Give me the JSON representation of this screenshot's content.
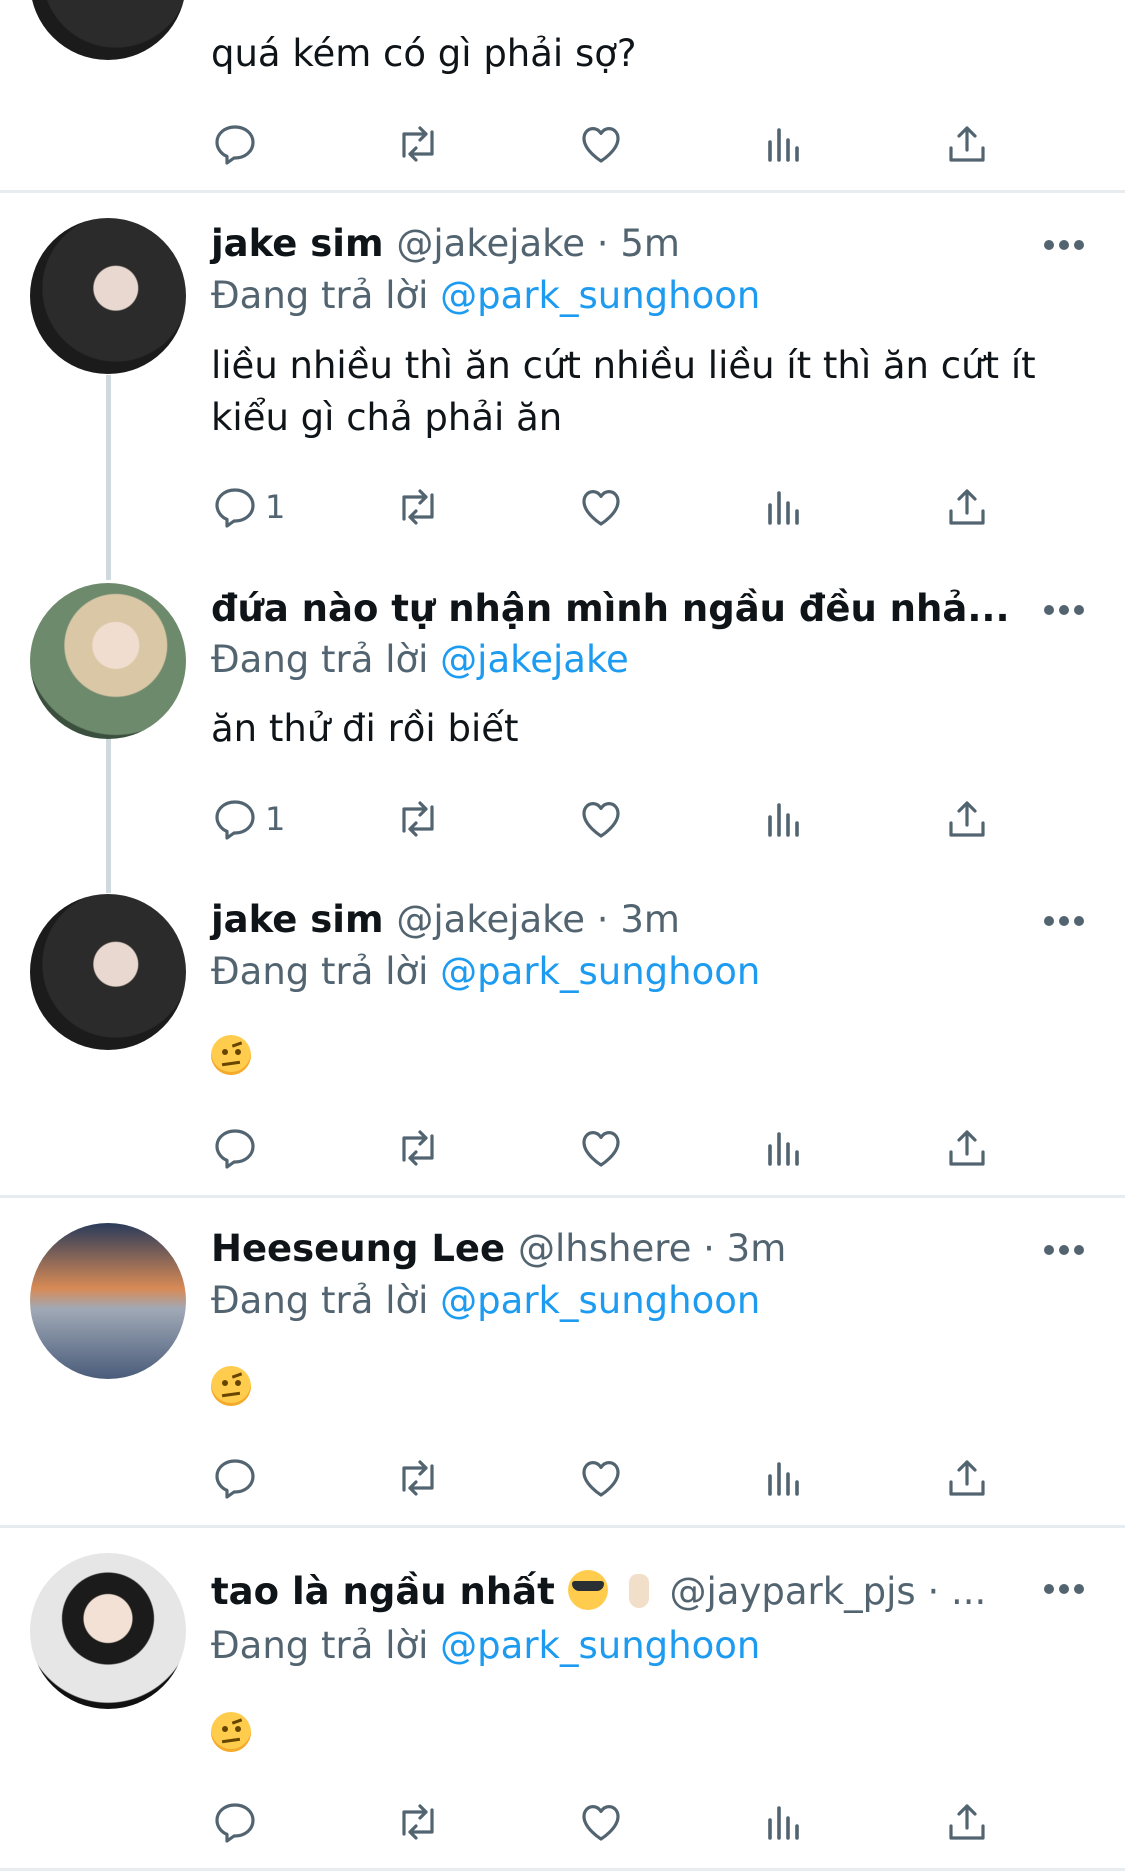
{
  "top_tweet": {
    "text": "quá kém có gì phải sợ?"
  },
  "tweets": [
    {
      "name": "jake sim",
      "handle_time": "@jakejake · 5m",
      "replying_label": "Đang trả lời",
      "replying_to": "@park_sunghoon",
      "text_line1": "liều nhiều thì ăn cứt nhiều liều ít thì ăn cứt ít",
      "text_line2": "kiểu gì chả phải ăn",
      "reply_count": "1"
    },
    {
      "name": "đứa nào tự nhận mình ngầu đều nhả...",
      "replying_label": "Đang trả lời",
      "replying_to": "@jakejake",
      "text_line1": "ăn thử đi rồi biết",
      "reply_count": "1"
    },
    {
      "name": "jake sim",
      "handle_time": "@jakejake · 3m",
      "replying_label": "Đang trả lời",
      "replying_to": "@park_sunghoon",
      "emoji": "raised-eyebrow-emoji"
    },
    {
      "name": "Heeseung Lee",
      "handle_time": "@lhshere · 3m",
      "replying_label": "Đang trả lời",
      "replying_to": "@park_sunghoon",
      "emoji": "raised-eyebrow-emoji"
    },
    {
      "name": "tao là ngầu nhất",
      "handle_time": "@jaypark_pjs · ...",
      "replying_label": "Đang trả lời",
      "replying_to": "@park_sunghoon",
      "emoji": "raised-eyebrow-emoji"
    }
  ],
  "icons": {
    "reply": "reply-icon",
    "retweet": "retweet-icon",
    "like": "heart-icon",
    "views": "analytics-icon",
    "share": "share-icon",
    "more": "more-icon"
  },
  "colors": {
    "link": "#1d9bf0",
    "secondary_text": "#536471",
    "divider": "#e6ecf0"
  }
}
